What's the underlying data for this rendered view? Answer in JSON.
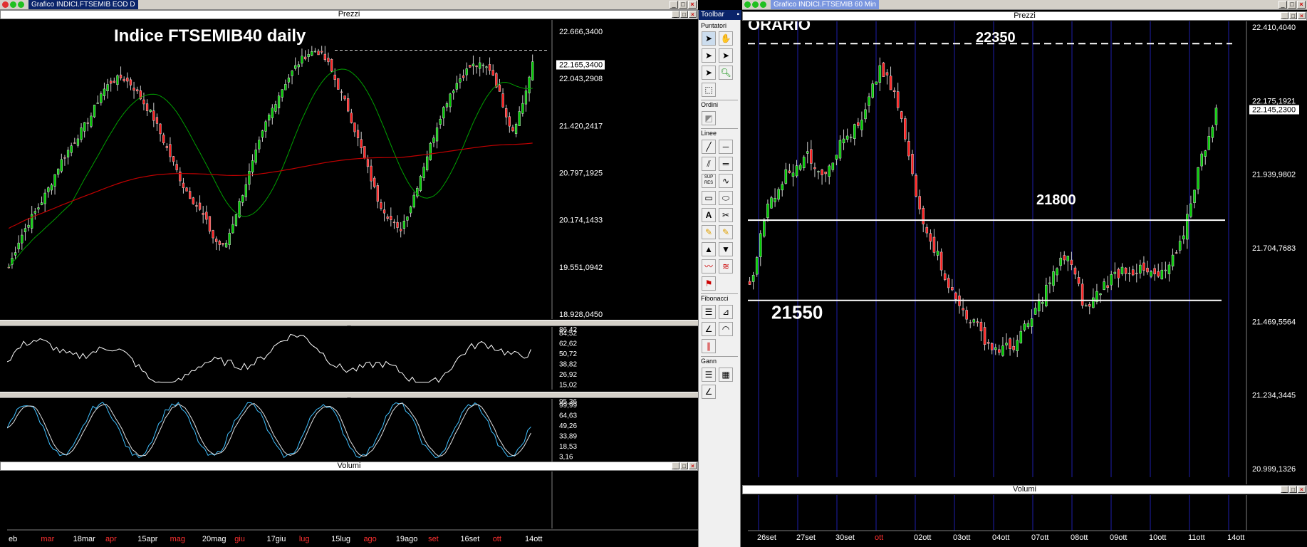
{
  "left_window": {
    "title": "Grafico INDICI.FTSEMIB EOD D",
    "pane_prices_label": "Prezzi",
    "pane_volumes_label": "Volumi",
    "chart_title": "Indice FTSEMIB40 daily",
    "price_axis_ticks": [
      "22.666,3400",
      "22.043,2908",
      "21.420,2417",
      "20.797,1925",
      "20.174,1433",
      "19.551,0942",
      "18.928,0450"
    ],
    "last_price_label": "22.165,3400",
    "osc1_ticks": [
      "84,52",
      "62,62",
      "50,72",
      "38,82",
      "26,92",
      "15,02"
    ],
    "osc1_top": "86,42",
    "osc2_ticks": [
      "99,99",
      "64,63",
      "49,26",
      "33,89",
      "18,53",
      "3,16"
    ],
    "osc2_top": "95,36",
    "month_labels": [
      "eb",
      "mar",
      "18mar",
      "apr",
      "15apr",
      "mag",
      "20mag",
      "giu",
      "17giu",
      "lug",
      "15lug",
      "ago",
      "19ago",
      "set",
      "16set",
      "ott",
      "14ott"
    ],
    "month_label_colors": [
      "#ffffff",
      "#ff3030",
      "#ffffff",
      "#ff3030",
      "#ffffff",
      "#ff3030",
      "#ffffff",
      "#ff3030",
      "#ffffff",
      "#ff3030",
      "#ffffff",
      "#ff3030",
      "#ffffff",
      "#ff3030",
      "#ffffff",
      "#ff3030",
      "#ffffff"
    ]
  },
  "right_window": {
    "title": "Grafico INDICI.FTSEMIB 60 Min",
    "pane_prices_label": "Prezzi",
    "pane_volumes_label": "Volumi",
    "corner_text": "ORARIO",
    "level_labels": [
      "22350",
      "21800",
      "21550"
    ],
    "price_axis_ticks": [
      "22.410,4040",
      "22.175,1921",
      "21.939,9802",
      "21.704,7683",
      "21.469,5564",
      "21.234,3445",
      "20.999,1326"
    ],
    "last_price_label": "22.145,2300",
    "date_labels": [
      "26set",
      "27set",
      "30set",
      "ott",
      "02ott",
      "03ott",
      "04ott",
      "07ott",
      "08ott",
      "09ott",
      "10ott",
      "11ott",
      "14ott"
    ],
    "date_label_colors": [
      "#ffffff",
      "#ffffff",
      "#ffffff",
      "#ff3030",
      "#ffffff",
      "#ffffff",
      "#ffffff",
      "#ffffff",
      "#ffffff",
      "#ffffff",
      "#ffffff",
      "#ffffff",
      "#ffffff"
    ]
  },
  "toolbar": {
    "title": "Toolbar",
    "groups": [
      "Puntatori",
      "Ordini",
      "Linee",
      "Fibonacci",
      "Gann"
    ]
  },
  "colors": {
    "bull": "#00cc00",
    "bear": "#ff2020",
    "ma_fast": "#00a000",
    "ma_slow": "#c00000",
    "osc_line": "#ffffff",
    "stoch_k": "#40c0ff",
    "stoch_d": "#e0e0e0",
    "grid_blue": "#1e1eaa"
  },
  "chart_data": [
    {
      "type": "candlestick",
      "title": "Indice FTSEMIB40 daily",
      "xlabel": "",
      "ylabel": "",
      "ylim": [
        18928.045,
        22666.34
      ],
      "x": [
        "eb",
        "mar",
        "18mar",
        "apr",
        "15apr",
        "mag",
        "20mag",
        "giu",
        "17giu",
        "lug",
        "15lug",
        "ago",
        "19ago",
        "set",
        "16set",
        "ott",
        "14ott"
      ],
      "close_path": [
        19550,
        19900,
        20150,
        20350,
        20600,
        20900,
        21100,
        21300,
        21500,
        21800,
        21950,
        22000,
        21900,
        21700,
        21500,
        21200,
        20900,
        20600,
        20400,
        20200,
        19900,
        19800,
        20200,
        20600,
        21000,
        21400,
        21700,
        21950,
        22150,
        22300,
        22350,
        22200,
        21900,
        21600,
        21200,
        20800,
        20400,
        20200,
        20000,
        20300,
        20700,
        21100,
        21500,
        21800,
        22000,
        22150,
        22150,
        22100,
        21700,
        21300,
        21650,
        22165
      ],
      "resistance_level": 22350,
      "series": [
        {
          "name": "",
          "kind": "sma-fast"
        },
        {
          "name": "",
          "kind": "sma-slow"
        }
      ]
    },
    {
      "type": "candlestick",
      "title": "",
      "ylim": [
        20999.1326,
        22410.404
      ],
      "x": [
        "26set",
        "27set",
        "30set",
        "ott",
        "02ott",
        "03ott",
        "04ott",
        "07ott",
        "08ott",
        "09ott",
        "10ott",
        "11ott",
        "14ott"
      ],
      "close_path": [
        21600,
        21850,
        21950,
        22000,
        21950,
        22050,
        22100,
        22280,
        22150,
        21850,
        21700,
        21550,
        21480,
        21400,
        21400,
        21480,
        21600,
        21700,
        21520,
        21600,
        21650,
        21640,
        21620,
        21700,
        21950,
        22145
      ],
      "levels": [
        22350,
        21800,
        21550
      ]
    }
  ]
}
